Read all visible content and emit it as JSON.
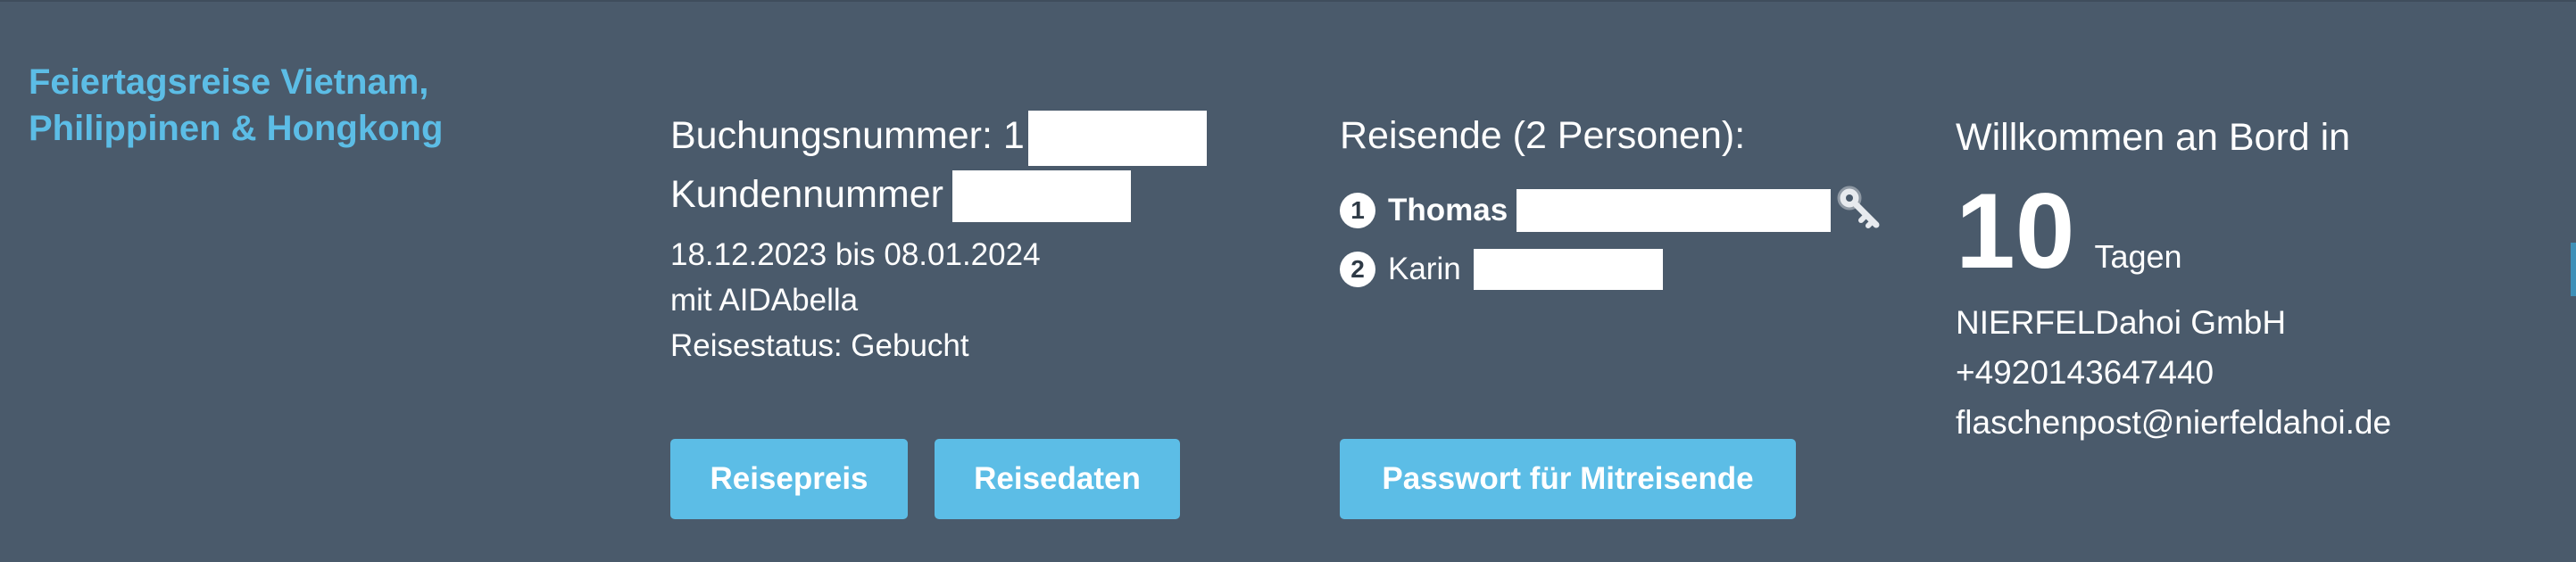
{
  "trip": {
    "title_line1": "Feiertagsreise Vietnam,",
    "title_line2": "Philippinen & Hongkong"
  },
  "booking": {
    "booking_number_label": "Buchungsnummer: 1",
    "customer_number_label": "Kundennummer",
    "dates": "18.12.2023 bis 08.01.2024",
    "ship": "mit AIDAbella",
    "status": "Reisestatus: Gebucht"
  },
  "travellers": {
    "heading": "Reisende (2 Personen):",
    "items": [
      {
        "number": "1",
        "name": "Thomas"
      },
      {
        "number": "2",
        "name": "Karin"
      }
    ],
    "key_icon": "key-icon"
  },
  "welcome": {
    "label": "Willkommen an Bord in",
    "count": "10",
    "unit": "Tagen",
    "company": "NIERFELDahoi GmbH",
    "phone": "+4920143647440",
    "email": "flaschenpost@nierfeldahoi.de"
  },
  "buttons": {
    "price": "Reisepreis",
    "data": "Reisedaten",
    "password": "Passwort für Mitreisende"
  },
  "colors": {
    "background": "#4a5a6b",
    "accent": "#5cbde6"
  }
}
